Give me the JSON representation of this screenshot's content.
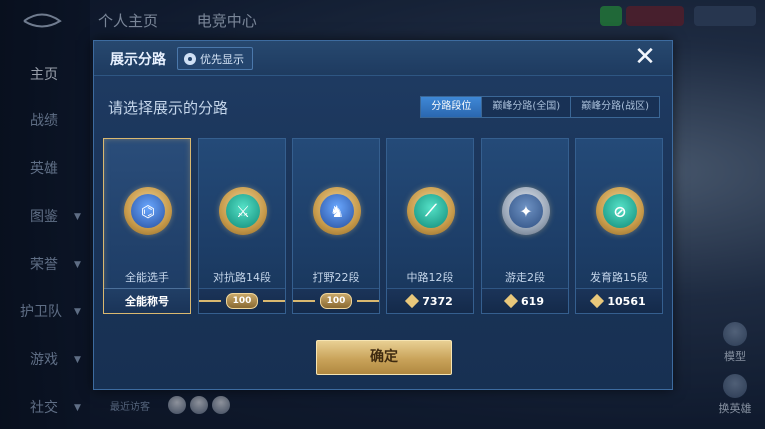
{
  "background": {
    "top_tabs": [
      "个人主页",
      "电竞中心"
    ],
    "sidebar": [
      {
        "label": "主页",
        "active": true
      },
      {
        "label": "战绩",
        "active": false
      },
      {
        "label": "英雄",
        "active": false
      },
      {
        "label": "图鉴",
        "active": false
      },
      {
        "label": "荣誉",
        "active": false
      },
      {
        "label": "护卫队",
        "active": false
      },
      {
        "label": "游戏",
        "active": false
      },
      {
        "label": "社交",
        "active": false
      }
    ],
    "right_buttons": [
      "模型",
      "换英雄"
    ],
    "recent_visitors_label": "最近访客"
  },
  "dialog": {
    "title": "展示分路",
    "priority_label": "优先显示",
    "close_icon": "close-icon",
    "prompt": "请选择展示的分路",
    "tabs": [
      {
        "label": "分路段位",
        "active": true
      },
      {
        "label": "巅峰分路(全国)",
        "active": false
      },
      {
        "label": "巅峰分路(战区)",
        "active": false
      }
    ],
    "cards": [
      {
        "name": "全能选手",
        "footer": "全能称号",
        "emblem": "all-round-emblem-icon",
        "glyph": "⌬",
        "style": "blue",
        "selected": true,
        "footer_type": "text"
      },
      {
        "name": "对抗路14段",
        "footer": "100",
        "emblem": "clash-lane-emblem-icon",
        "glyph": "⚔",
        "style": "teal",
        "selected": false,
        "footer_type": "badge"
      },
      {
        "name": "打野22段",
        "footer": "100",
        "emblem": "jungle-emblem-icon",
        "glyph": "♞",
        "style": "blue",
        "selected": false,
        "footer_type": "badge"
      },
      {
        "name": "中路12段",
        "footer": "7372",
        "emblem": "mid-lane-emblem-icon",
        "glyph": "⟋",
        "style": "teal",
        "selected": false,
        "footer_type": "score"
      },
      {
        "name": "游走2段",
        "footer": "619",
        "emblem": "roam-emblem-icon",
        "glyph": "✦",
        "style": "silver",
        "selected": false,
        "footer_type": "score"
      },
      {
        "name": "发育路15段",
        "footer": "10561",
        "emblem": "farm-lane-emblem-icon",
        "glyph": "⊘",
        "style": "teal",
        "selected": false,
        "footer_type": "score"
      }
    ],
    "confirm_label": "确定"
  }
}
